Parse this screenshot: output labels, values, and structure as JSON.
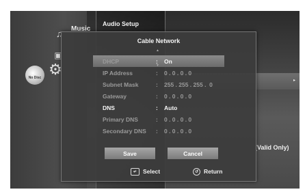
{
  "sidebar": {
    "items": [
      {
        "label": "Music",
        "icon": "music-note-icon"
      },
      {
        "label": "",
        "icon": "photo-icon"
      },
      {
        "label": "",
        "icon": "gear-icon"
      }
    ],
    "disc_status": "No Disc"
  },
  "menu": {
    "title": "Audio Setup",
    "arrow": "▸"
  },
  "background_text": "(Valid Only)",
  "dialog": {
    "title": "Cable Network",
    "scroll_up": "▲",
    "scroll_down": "▼",
    "rows": [
      {
        "label": "DHCP",
        "colon": ":",
        "value": "On"
      },
      {
        "label": "IP Address",
        "colon": ":",
        "value": "0 . 0 . 0 . 0"
      },
      {
        "label": "Subnet Mask",
        "colon": ":",
        "value": "255 . 255 . 255 .  0"
      },
      {
        "label": "Gateway",
        "colon": ":",
        "value": "0 . 0 . 0 . 0"
      },
      {
        "label": "DNS",
        "colon": ":",
        "value": "Auto"
      },
      {
        "label": "Primary DNS",
        "colon": ":",
        "value": "0 . 0 . 0 . 0"
      },
      {
        "label": "Secondary DNS",
        "colon": ":",
        "value": "0 . 0 . 0 . 0"
      }
    ],
    "buttons": {
      "save": "Save",
      "cancel": "Cancel"
    },
    "footer": {
      "select": "Select",
      "return": "Return"
    }
  }
}
